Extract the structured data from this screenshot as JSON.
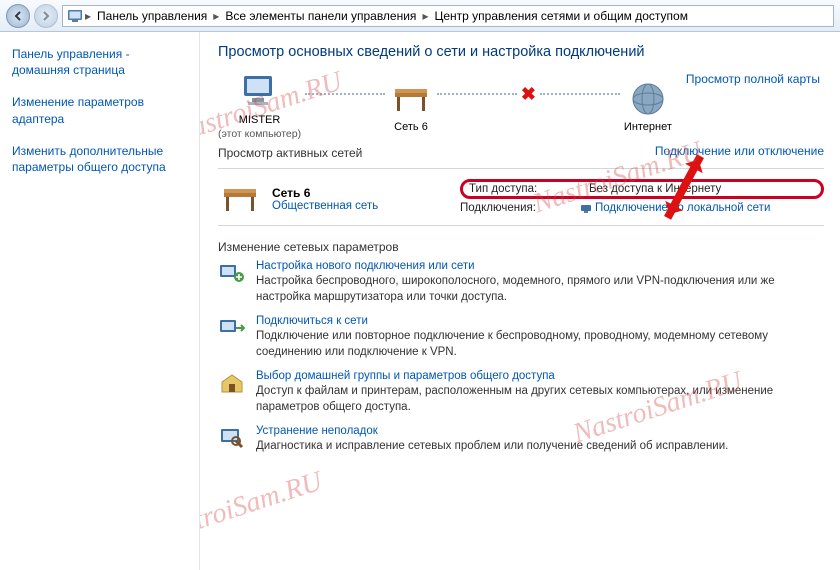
{
  "breadcrumb": {
    "items": [
      "Панель управления",
      "Все элементы панели управления",
      "Центр управления сетями и общим доступом"
    ]
  },
  "sidebar": {
    "home": "Панель управления - домашняя страница",
    "adapter": "Изменение параметров адаптера",
    "sharing": "Изменить дополнительные параметры общего доступа"
  },
  "heading": "Просмотр основных сведений о сети и настройка подключений",
  "map": {
    "node1": {
      "name": "MISTER",
      "sub": "(этот компьютер)"
    },
    "node2": {
      "name": "Сеть 6"
    },
    "node3": {
      "name": "Интернет"
    },
    "fullMap": "Просмотр полной карты"
  },
  "activeNetworks": {
    "label": "Просмотр активных сетей",
    "connectLink": "Подключение или отключение",
    "net": {
      "name": "Сеть 6",
      "type": "Общественная сеть",
      "accessKey": "Тип доступа:",
      "accessVal": "Без доступа к Интернету",
      "connKey": "Подключения:",
      "connVal": "Подключение по локальной сети"
    }
  },
  "params": {
    "heading": "Изменение сетевых параметров",
    "tasks": [
      {
        "title": "Настройка нового подключения или сети",
        "desc": "Настройка беспроводного, широкополосного, модемного, прямого или VPN-подключения или же настройка маршрутизатора или точки доступа."
      },
      {
        "title": "Подключиться к сети",
        "desc": "Подключение или повторное подключение к беспроводному, проводному, модемному сетевому соединению или подключение к VPN."
      },
      {
        "title": "Выбор домашней группы и параметров общего доступа",
        "desc": "Доступ к файлам и принтерам, расположенным на других сетевых компьютерах, или изменение параметров общего доступа."
      },
      {
        "title": "Устранение неполадок",
        "desc": "Диагностика и исправление сетевых проблем или получение сведений об исправлении."
      }
    ]
  },
  "watermark": "NastroiSam.RU"
}
